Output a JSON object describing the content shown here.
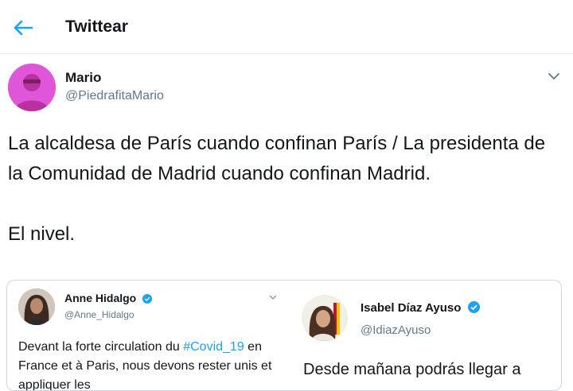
{
  "header": {
    "title": "Twittear",
    "back_icon": "arrow-left-icon"
  },
  "tweet": {
    "author_name": "Mario",
    "author_handle": "@PiedrafitaMario",
    "text_line1": "La alcaldesa de París cuando confinan París / La presidenta de la Comunidad de Madrid cuando confinan Madrid.",
    "text_line2": "El nivel."
  },
  "embedded": {
    "left": {
      "name": "Anne Hidalgo",
      "handle": "@Anne_Hidalgo",
      "text_part1": "Devant la forte circulation du ",
      "hashtag": "#Covid_19",
      "text_part2": " en France et à Paris, nous devons rester unis et appliquer les"
    },
    "right": {
      "name": "Isabel Díaz Ayuso",
      "handle": "@IdiazAyuso",
      "text": "Desde mañana podrás llegar a"
    }
  },
  "colors": {
    "accent": "#1da1f2",
    "verified": "#1da1f2",
    "avatar_pink": "#e056d8"
  }
}
